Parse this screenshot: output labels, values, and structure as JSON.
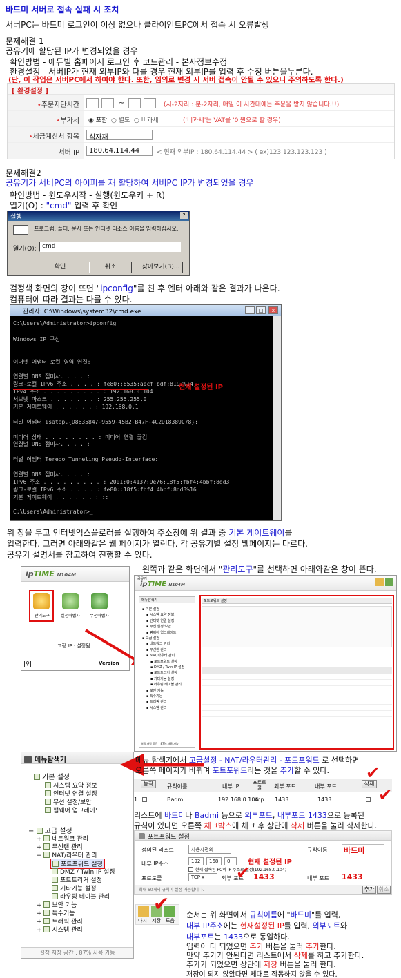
{
  "title": "바드미 서버로 접속 실패 시 조치",
  "intro": "서버PC는 바드미 로그인이 이상 없으나 클라이언트PC에서 접속 시 오류발생",
  "solution1": {
    "heading": "문제해결 1",
    "cause": "공유기에 할당된 IP가 변경되었을 경우",
    "check": "확인방법 - 에듀빌 홈페이지 로그인 후 코드관리 - 본사정보수정",
    "setting": "환경설정 - 서버IP가 현재 외부IP와 다를 경우 현재 외부IP를 입력 후 수정 버튼을누른다.",
    "warning": "(단, 이 작업은 서버PC에서 하여야 한다. 또한, 임의로 변경 시 서버 접속이 안될 수 있으니 주의하도록 한다.)"
  },
  "env_panel": {
    "title": "[ 환경설정 ]",
    "order_label": "주문자단시간",
    "order_sep": "~",
    "order_hint": "(시-2자리 : 분-2자리, 매일 이 시간대에는 주문을 받지 않습니다.!!)",
    "vat_label": "부가세",
    "vat_options": [
      "포함",
      "별도",
      "비과세"
    ],
    "vat_hint": "('비과세'는 VAT를 '0'원으로 할 경우)",
    "tax_label": "세금계산서 항목",
    "tax_value": "식자재",
    "ip_label": "서버 IP",
    "ip_value": "180.64.114.44",
    "ip_hint": "< 현재 외부IP : 180.64.114.44 > ( ex)123.123.123.123 )"
  },
  "solution2": {
    "heading": "문제해결2",
    "cause": "공유기가 서버PC의 아이피를 재 할당하여 서버PC IP가 변경되었을 경우",
    "check": "확인방법 - 윈도우시작 - 실행(윈도우키 + R)",
    "open_prefix": "열기(O) : ",
    "open_cmd": "\"cmd\"",
    "open_suffix": " 입력 후 확인"
  },
  "run_dialog": {
    "title": "실행",
    "close": "?",
    "desc": "프로그램, 폴더, 문서 또는 인터넷 리소스 이름을 입력하십시오.",
    "open_label": "열기(O):",
    "open_value": "cmd",
    "ok": "확인",
    "cancel": "취소",
    "browse": "찾아보기(B)..."
  },
  "cmd_desc": {
    "line1_pre": "검정색 화면의 창이 뜨면 \"",
    "line1_cmd": "ipconfig",
    "line1_post": "\"를 친 후 엔터 아래와 같은 결과가 나온다.",
    "line2": "컴퓨터에 따라 결과는 다를 수 있다."
  },
  "cmd_window": {
    "title": "관리자: C:\\Windows\\system32\\cmd.exe",
    "lines": [
      "C:\\Users\\Administrator>ipconfig",
      "",
      "Windows IP 구성",
      "",
      "",
      "이더넷 어댑터 로컬 영역 연결:",
      "",
      "   연결별 DNS 접미사. . . . :",
      "   링크-로컬 IPv6 주소 . . . . : fe80::8535:aecf:bdf:8197%14",
      "   IPv4 주소 . . . . . . . . . : 192.168.0.104",
      "   서브넷 마스크 . . . . . . . : 255.255.255.0",
      "   기본 게이트웨이 . . . . . . : 192.168.0.1",
      "",
      "터널 어댑터 isatap.{D8635847-9559-45B2-B47F-4C2D18389C78}:",
      "",
      "   미디어 상태 . . . . . . . . : 미디어 연결 끊김",
      "   연결별 DNS 접미사. . . . :",
      "",
      "터널 어댑터 Teredo Tunneling Pseudo-Interface:",
      "",
      "   연결별 DNS 접미사. . . . :",
      "   IPv6 주소 . . . . . . . . . : 2001:0:4137:9e76:18f5:fbf4:4bbf:8dd3",
      "   링크-로컬 IPv6 주소 . . . . : fe80::18f5:fbf4:4bbf:8dd3%16",
      "   기본 게이트웨이 . . . . . . : ::",
      "",
      "C:\\Users\\Administrator>_"
    ],
    "annotation": "현재 설정된 IP"
  },
  "gateway_desc": {
    "l1_pre": "위 창을 두고 인터넷익스플로러를 실행하여 주소창에 위 결과 중 ",
    "l1_hl": "기본 게이트웨이",
    "l1_post": "를",
    "l2": "입력한다. 그러면 아래와같은 웹 페이지가 열린다. 각 공유기별 설정 웹페이지는 다르다.",
    "l3": "공유기 설명서를 참고하여 진행할 수 있다."
  },
  "router_home": {
    "logo_pre": "ip",
    "logo_brand": "TIME",
    "model": "N104M",
    "icons": [
      "관리도구",
      "설정마법사",
      "무선마법사"
    ],
    "status": "고정 IP : 설정됨",
    "version": "Version"
  },
  "admin_desc": {
    "pre": "왼쪽과 같은 화면에서 \"",
    "hl": "관리도구",
    "post": "\"를 선택하면 아래와같은 창이 뜬다."
  },
  "router_admin": {
    "small_title": "공유기",
    "menu_title": "메뉴탐색기",
    "content_title": "포트포워드 설정",
    "storage": "설정 저장 공간 : 87% 사용 가능"
  },
  "menu_explorer": {
    "title": "메뉴탐색기",
    "basic": "기본 설정",
    "basic_items": [
      "시스템 요약 정보",
      "인터넷 연결 설정",
      "무선 설정/보안",
      "펌웨어 업그레이드"
    ],
    "advanced": "고급 설정",
    "network": "네트워크 관리",
    "wireless": "무선랜 관리",
    "nat": "NAT/라우터 관리",
    "nat_items": [
      "포트포워드 설정",
      "DMZ / Twin IP 설정",
      "포트트리거 설정",
      "기타기능 설정",
      "라우팅 테이블 관리"
    ],
    "others": [
      "보안 기능",
      "특수기능",
      "트래픽 관리",
      "시스템 관리"
    ],
    "storage": "설정 저장 공간 : 87% 사용 가능"
  },
  "pf_desc": {
    "l1_pre": "메뉴 탐색기에서 ",
    "l1_hl": "고급설정 - NAT/라우터관리 - 포트포워드",
    "l1_post": " 로 선택하면",
    "l2_pre": "오른쪽 페이지가 바뀌며 ",
    "l2_hl": "포트포워드",
    "l2_mid": "라는 것을 ",
    "l2_add": "추가",
    "l2_post": "할 수 있다."
  },
  "pf_table": {
    "headers": [
      "동작",
      "규칙이름",
      "내부 IP",
      "프로토콜",
      "외부 포트",
      "내부 포트",
      "삭제"
    ],
    "row": {
      "no": "1",
      "name": "Badmi",
      "ip": "192.168.0.104",
      "proto": "tcp",
      "ext": "1433",
      "int": "1433"
    }
  },
  "delete_desc": {
    "l1_pre": "리스트에 ",
    "l1_a": "바드미",
    "l1_b": "나 ",
    "l1_c": "Badmi",
    "l1_d": " 등으로 ",
    "l1_e": "외부포트",
    "l1_f": ", ",
    "l1_g": "내부포트",
    "l1_h": " 1433",
    "l1_i": "으로 등록된",
    "l2_pre": "규칙이 있다면 오른쪽 ",
    "l2_hl": "체크박스",
    "l2_mid": "에 체크 후 상단에 ",
    "l2_del": "삭제",
    "l2_post": " 버튼을 눌러 삭제한다."
  },
  "pf_form": {
    "title": "포트포워드 설정",
    "policy_label": "정의된 리스트",
    "policy_value": "사용자정의",
    "rule_label": "규칙이름",
    "rule_value": "바드미",
    "ip_label": "내부 IP주소",
    "ip_parts": [
      "192",
      "168",
      "0"
    ],
    "ip_note": "현재 설정된 IP",
    "checkbox_label": "현재 접속된 PC의 IP 주소로 설정(192.168.0.104)",
    "proto_label": "프로토콜",
    "proto_value": "TCP",
    "ext_label": "외부 포트",
    "ext_value": "1433",
    "int_label": "내부 포트",
    "int_value": "1433",
    "footer": "최대 60개의 규칙이 설정 가능합니다.",
    "add": "추가",
    "cancel": "취소"
  },
  "save_icons": [
    "다시",
    "저장",
    "도움"
  ],
  "final_desc": {
    "l1_pre": "순서는 위 화면에서 ",
    "l1_a": "규칙이름",
    "l1_b": "에 \"",
    "l1_c": "바드미",
    "l1_d": "\"를 입력,",
    "l2_a": "내부 IP주소",
    "l2_b": "에는 ",
    "l2_c": "현재설정된 IP",
    "l2_d": "를 입력, ",
    "l2_e": "외부포트",
    "l2_f": "와",
    "l3_a": "내부포트",
    "l3_b": "는 ",
    "l3_c": "1433",
    "l3_d": "으로 동일하다.",
    "l4_a": "입력이 다 되었으면 ",
    "l4_b": "추가",
    "l4_c": " 버튼을 눌러 ",
    "l4_d": "추가",
    "l4_e": "한다.",
    "l5_a": "만약 추가가 안된다면 리스트에서 ",
    "l5_b": "삭제",
    "l5_c": "를 하고 추가한다.",
    "l6_a": "추가가 되었으면 상단에 ",
    "l6_b": "저장",
    "l6_c": " 버튼을 눌러     한다.",
    "l7": "저장이 되지 않았다면 제대로 작동하지 않을 수 있다."
  }
}
